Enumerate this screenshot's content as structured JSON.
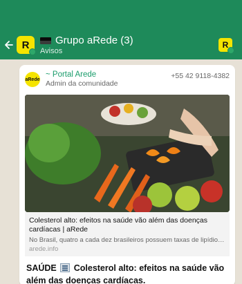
{
  "header": {
    "title": "Grupo aRede (3)",
    "subtitle": "Avisos",
    "avatar_letter": "R",
    "right_avatar_letter": "R"
  },
  "message": {
    "sender_name": "~ Portal Arede",
    "sender_role": "Admin da comunidade",
    "sender_phone": "+55 42 9118-4382",
    "logo_text": "aRede",
    "link_preview": {
      "title": "Colesterol alto: efeitos na saúde vão além das doenças cardíacas | aRede",
      "description": "No Brasil, quatro a cada dez brasileiros possuem taxas de lipídio elevadas, de ...",
      "domain": "arede.info"
    },
    "body_prefix": "SAÚDE",
    "body_text": "Colesterol alto: efeitos na saúde vão além das doenças cardíacas."
  },
  "colors": {
    "header_green": "#1e8a5a",
    "sender_green": "#1a9c6b",
    "brand_yellow": "#f5e400"
  }
}
